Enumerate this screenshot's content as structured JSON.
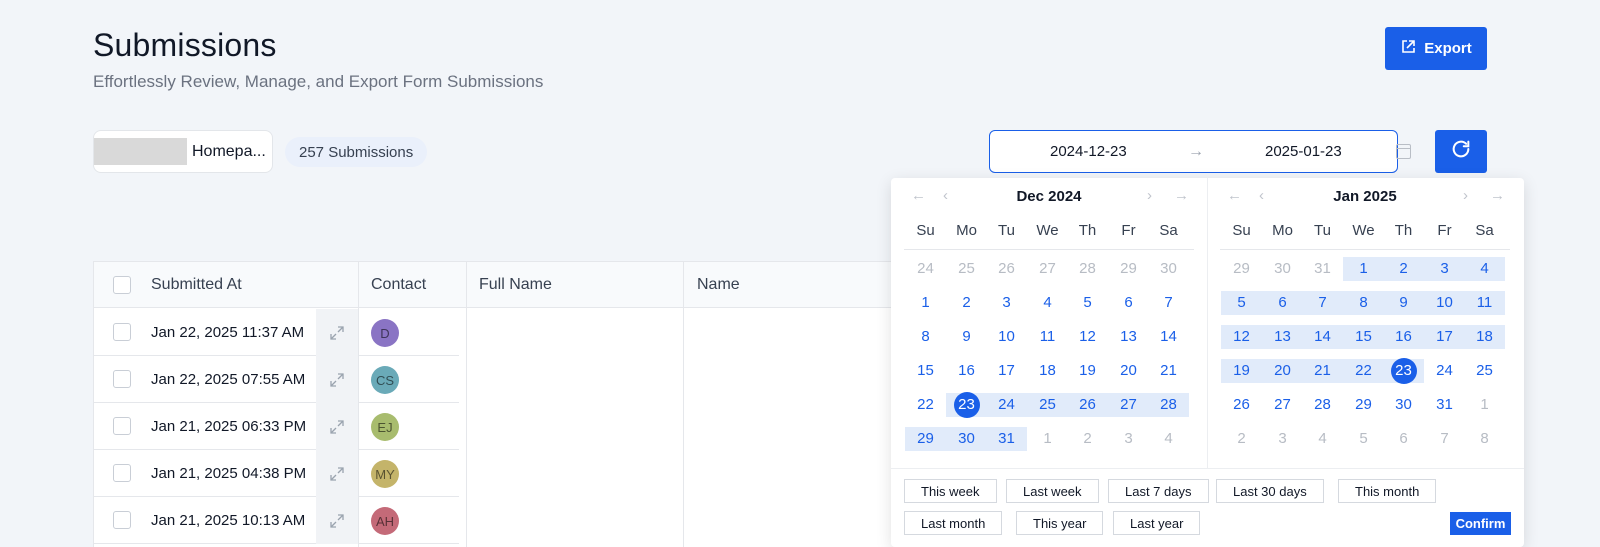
{
  "header": {
    "title": "Submissions",
    "subtitle": "Effortlessly Review, Manage, and Export Form Submissions",
    "export_label": "Export"
  },
  "filters": {
    "form_name": "Homepa...",
    "submission_count": "257 Submissions",
    "date_start": "2024-12-23",
    "date_end": "2025-01-23"
  },
  "table": {
    "columns": [
      "Submitted At",
      "Contact",
      "Full Name",
      "Name"
    ],
    "rows": [
      {
        "date": "Jan 22, 2025 11:37 AM",
        "initials": "D",
        "color": "#8a74c4"
      },
      {
        "date": "Jan 22, 2025 07:55 AM",
        "initials": "CS",
        "color": "#6aaab8"
      },
      {
        "date": "Jan 21, 2025 06:33 PM",
        "initials": "EJ",
        "color": "#a8bc6e"
      },
      {
        "date": "Jan 21, 2025 04:38 PM",
        "initials": "MY",
        "color": "#c4b46a"
      },
      {
        "date": "Jan 21, 2025 10:13 AM",
        "initials": "AH",
        "color": "#c46a78"
      }
    ]
  },
  "picker": {
    "weekdays": [
      "Su",
      "Mo",
      "Tu",
      "We",
      "Th",
      "Fr",
      "Sa"
    ],
    "months": [
      {
        "label": "Dec 2024",
        "days": [
          [
            "24",
            "25",
            "26",
            "27",
            "28",
            "29",
            "30"
          ],
          [
            "1",
            "2",
            "3",
            "4",
            "5",
            "6",
            "7"
          ],
          [
            "8",
            "9",
            "10",
            "11",
            "12",
            "13",
            "14"
          ],
          [
            "15",
            "16",
            "17",
            "18",
            "19",
            "20",
            "21"
          ],
          [
            "22",
            "23",
            "24",
            "25",
            "26",
            "27",
            "28"
          ],
          [
            "29",
            "30",
            "31",
            "1",
            "2",
            "3",
            "4"
          ]
        ],
        "muted": [
          [
            0,
            0
          ],
          [
            0,
            1
          ],
          [
            0,
            2
          ],
          [
            0,
            3
          ],
          [
            0,
            4
          ],
          [
            0,
            5
          ],
          [
            0,
            6
          ],
          [
            5,
            3
          ],
          [
            5,
            4
          ],
          [
            5,
            5
          ],
          [
            5,
            6
          ]
        ],
        "range": [
          [
            4,
            1
          ],
          [
            4,
            2
          ],
          [
            4,
            3
          ],
          [
            4,
            4
          ],
          [
            4,
            5
          ],
          [
            4,
            6
          ],
          [
            5,
            0
          ],
          [
            5,
            1
          ],
          [
            5,
            2
          ]
        ],
        "selected": [
          [
            4,
            1
          ]
        ]
      },
      {
        "label": "Jan 2025",
        "days": [
          [
            "29",
            "30",
            "31",
            "1",
            "2",
            "3",
            "4"
          ],
          [
            "5",
            "6",
            "7",
            "8",
            "9",
            "10",
            "11"
          ],
          [
            "12",
            "13",
            "14",
            "15",
            "16",
            "17",
            "18"
          ],
          [
            "19",
            "20",
            "21",
            "22",
            "23",
            "24",
            "25"
          ],
          [
            "26",
            "27",
            "28",
            "29",
            "30",
            "31",
            "1"
          ],
          [
            "2",
            "3",
            "4",
            "5",
            "6",
            "7",
            "8"
          ]
        ],
        "muted": [
          [
            0,
            0
          ],
          [
            0,
            1
          ],
          [
            0,
            2
          ],
          [
            4,
            6
          ],
          [
            5,
            0
          ],
          [
            5,
            1
          ],
          [
            5,
            2
          ],
          [
            5,
            3
          ],
          [
            5,
            4
          ],
          [
            5,
            5
          ],
          [
            5,
            6
          ]
        ],
        "range": [
          [
            0,
            3
          ],
          [
            0,
            4
          ],
          [
            0,
            5
          ],
          [
            0,
            6
          ],
          [
            1,
            0
          ],
          [
            1,
            1
          ],
          [
            1,
            2
          ],
          [
            1,
            3
          ],
          [
            1,
            4
          ],
          [
            1,
            5
          ],
          [
            1,
            6
          ],
          [
            2,
            0
          ],
          [
            2,
            1
          ],
          [
            2,
            2
          ],
          [
            2,
            3
          ],
          [
            2,
            4
          ],
          [
            2,
            5
          ],
          [
            2,
            6
          ],
          [
            3,
            0
          ],
          [
            3,
            1
          ],
          [
            3,
            2
          ],
          [
            3,
            3
          ],
          [
            3,
            4
          ]
        ],
        "selected": [
          [
            3,
            4
          ]
        ]
      }
    ],
    "presets_row1": [
      "This week",
      "Last week",
      "Last 7 days",
      "Last 30 days",
      "This month"
    ],
    "presets_row2": [
      "Last month",
      "This year",
      "Last year"
    ],
    "confirm_label": "Confirm"
  },
  "colors": {
    "primary": "#1a5fe8",
    "range_bg": "#e1ebfa",
    "page_bg": "#f2f5f9"
  }
}
